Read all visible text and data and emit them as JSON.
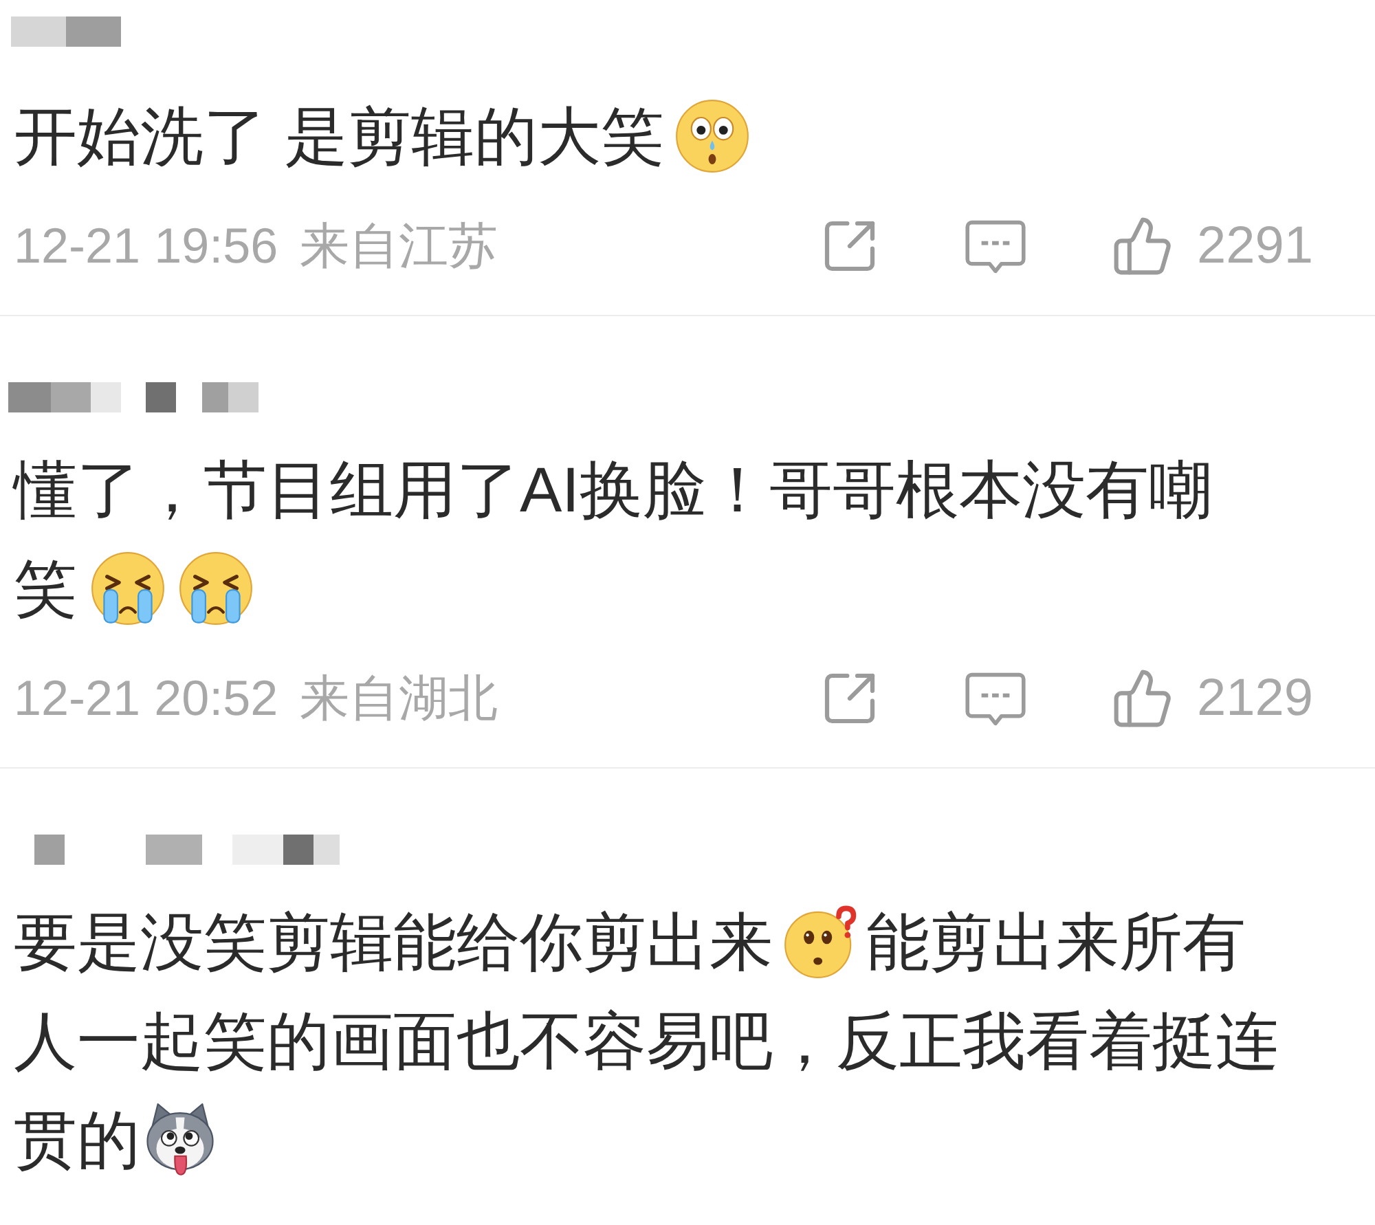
{
  "comments": [
    {
      "lines": [
        [
          {
            "kind": "text",
            "text": "开始洗了 是剪辑的大笑"
          },
          {
            "kind": "surprised"
          }
        ]
      ],
      "time": "12-21 19:56",
      "location": "来自江苏",
      "likes": "2291"
    },
    {
      "lines": [
        [
          {
            "kind": "text",
            "text": "懂了，节目组用了AI换脸！哥哥根本没有嘲"
          }
        ],
        [
          {
            "kind": "text",
            "text": "笑"
          },
          {
            "kind": "crying"
          },
          {
            "kind": "crying"
          }
        ]
      ],
      "time": "12-21 20:52",
      "location": "来自湖北",
      "likes": "2129"
    },
    {
      "lines": [
        [
          {
            "kind": "text",
            "text": "要是没笑剪辑能给你剪出来"
          },
          {
            "kind": "puzzled"
          },
          {
            "kind": "text",
            "text": "能剪出来所有"
          }
        ],
        [
          {
            "kind": "text",
            "text": "人一起笑的画面也不容易吧，反正我看着挺连"
          }
        ],
        [
          {
            "kind": "text",
            "text": "贯的"
          },
          {
            "kind": "husky"
          }
        ]
      ]
    }
  ]
}
